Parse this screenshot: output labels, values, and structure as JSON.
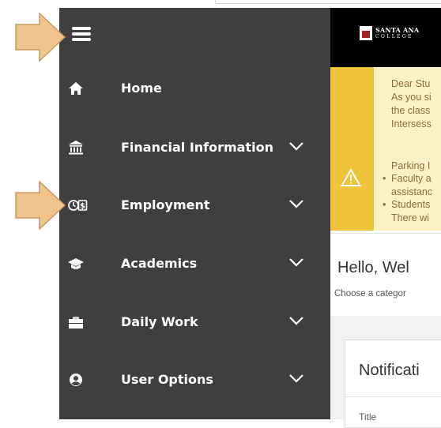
{
  "sidebar": {
    "items": [
      {
        "label": "Home",
        "icon": "home-icon",
        "has_chevron": false
      },
      {
        "label": "Financial Information",
        "icon": "bank-icon",
        "has_chevron": true
      },
      {
        "label": "Employment",
        "icon": "clock-dollar-icon",
        "has_chevron": true
      },
      {
        "label": "Academics",
        "icon": "graduation-cap-icon",
        "has_chevron": true
      },
      {
        "label": "Daily Work",
        "icon": "briefcase-icon",
        "has_chevron": true
      },
      {
        "label": "User Options",
        "icon": "user-icon",
        "has_chevron": true
      }
    ]
  },
  "header": {
    "logo_line1": "SANTA ANA",
    "logo_line2": "COLLEGE"
  },
  "alert": {
    "lines": [
      "Dear Stu",
      "As you si",
      "the class",
      "Intersess"
    ],
    "parking": "Parking I",
    "bullets": [
      {
        "lines": [
          "Faculty a",
          "assistanc"
        ]
      },
      {
        "lines": [
          "Students",
          "There wi"
        ]
      }
    ]
  },
  "main": {
    "greeting": "Hello, Wel",
    "subtitle": "Choose a categor"
  },
  "notifications": {
    "title": "Notificati",
    "column_title": "Title"
  },
  "colors": {
    "sidebar_bg": "#3f3f3f",
    "header_bg": "#000000",
    "alert_bg": "#fef1c6",
    "alert_strip": "#f0c43a",
    "alert_text": "#8a6d3b",
    "annotation_arrow": "#f2c48d"
  }
}
